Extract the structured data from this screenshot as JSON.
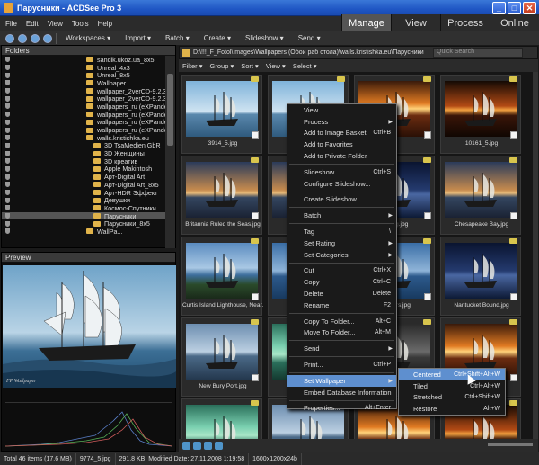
{
  "window": {
    "title": "Парусники - ACDSee Pro 3"
  },
  "menu": [
    "File",
    "Edit",
    "View",
    "Tools",
    "Help"
  ],
  "modes": [
    {
      "label": "Manage",
      "active": true
    },
    {
      "label": "View"
    },
    {
      "label": "Process"
    },
    {
      "label": "Online"
    }
  ],
  "toolbar": [
    "Workspaces ▾",
    "Import ▾",
    "Batch ▾",
    "Create ▾",
    "Slideshow ▾",
    "Send ▾"
  ],
  "folders": {
    "title": "Folders",
    "items": [
      {
        "label": "sandik.ukoz.ua_8x5",
        "indent": 0
      },
      {
        "label": "Unreal_4x3",
        "indent": 0
      },
      {
        "label": "Unreal_8x5",
        "indent": 0
      },
      {
        "label": "Wallpaper",
        "indent": 0
      },
      {
        "label": "wallpaper_2verCD-9.2.3_4x3",
        "indent": 0
      },
      {
        "label": "wallpaper_2verCD-9.2.3_8x5",
        "indent": 0
      },
      {
        "label": "wallpapers_ru (eXPanded)-1",
        "indent": 0
      },
      {
        "label": "wallpapers_ru (eXPanded)-1_",
        "indent": 0
      },
      {
        "label": "wallpapers_ru (eXPanded)-2",
        "indent": 0
      },
      {
        "label": "wallpapers_ru (eXPanded)-2_",
        "indent": 0
      },
      {
        "label": "walls.kristishka.eu",
        "indent": 0
      },
      {
        "label": "3D TsaMedien GbR",
        "indent": 1
      },
      {
        "label": "3D Женщины",
        "indent": 1
      },
      {
        "label": "3D креатив",
        "indent": 1
      },
      {
        "label": "Apple Makintosh",
        "indent": 1
      },
      {
        "label": "Арт-Digital Art",
        "indent": 1
      },
      {
        "label": "Арт-Digital Art_8x5",
        "indent": 1
      },
      {
        "label": "Арт-HDR Эффект",
        "indent": 1
      },
      {
        "label": "Девушки",
        "indent": 1
      },
      {
        "label": "Космос-Спутники",
        "indent": 1
      },
      {
        "label": "Парусники",
        "indent": 1,
        "selected": true
      },
      {
        "label": "Парусники_8x5",
        "indent": 1
      },
      {
        "label": "WallPa...",
        "indent": 0
      }
    ]
  },
  "preview": {
    "title": "Preview",
    "signature": "FP Wallpaper"
  },
  "path": {
    "text": "D:\\!!!_F_Fotol\\Images\\Wallpapers (Обои раб стола)\\walls.kristishka.eu\\Парусники",
    "search_placeholder": "Quick Search"
  },
  "filterbar": [
    "Filter ▾",
    "Group ▾",
    "Sort ▾",
    "View ▾",
    "Select ▾"
  ],
  "thumbnails": [
    {
      "caption": "3914_5.jpg",
      "scene": "ship-day"
    },
    {
      "caption": "3...",
      "scene": "ship-day"
    },
    {
      "caption": "",
      "scene": "sunset"
    },
    {
      "caption": "10161_5.jpg",
      "scene": "sunset-dark"
    },
    {
      "caption": "Britannia Ruled the Seas.jpg",
      "scene": "dusk"
    },
    {
      "caption": "Cha...",
      "scene": "dusk"
    },
    {
      "caption": "...ning.jpg",
      "scene": "night"
    },
    {
      "caption": "Chesapeake Bay.jpg",
      "scene": "dusk"
    },
    {
      "caption": "Curtis Island Lighthouse, Near...",
      "scene": "coast"
    },
    {
      "caption": "December...",
      "scene": "blue"
    },
    {
      "caption": "...velers.jpg",
      "scene": "blue"
    },
    {
      "caption": "Nantucket Bound.jpg",
      "scene": "night"
    },
    {
      "caption": "New Bury Port.jpg",
      "scene": "harbor"
    },
    {
      "caption": "New...",
      "scene": "green"
    },
    {
      "caption": "",
      "scene": "storm"
    },
    {
      "caption": "",
      "scene": "sunset"
    },
    {
      "caption": "",
      "scene": "green"
    },
    {
      "caption": "",
      "scene": "harbor"
    },
    {
      "caption": "",
      "scene": "sunset"
    },
    {
      "caption": "",
      "scene": "sunset-dark"
    }
  ],
  "context_menu": [
    {
      "label": "View"
    },
    {
      "label": "Process",
      "submenu": true
    },
    {
      "label": "Add to Image Basket",
      "shortcut": "Ctrl+B"
    },
    {
      "label": "Add to Favorites"
    },
    {
      "label": "Add to Private Folder"
    },
    {
      "divider": true
    },
    {
      "label": "Slideshow...",
      "shortcut": "Ctrl+S"
    },
    {
      "label": "Configure Slideshow..."
    },
    {
      "divider": true
    },
    {
      "label": "Create Slideshow..."
    },
    {
      "divider": true
    },
    {
      "label": "Batch",
      "submenu": true
    },
    {
      "divider": true
    },
    {
      "label": "Tag",
      "shortcut": "\\"
    },
    {
      "label": "Set Rating",
      "submenu": true
    },
    {
      "label": "Set Categories",
      "submenu": true
    },
    {
      "divider": true
    },
    {
      "label": "Cut",
      "shortcut": "Ctrl+X"
    },
    {
      "label": "Copy",
      "shortcut": "Ctrl+C"
    },
    {
      "label": "Delete",
      "shortcut": "Delete"
    },
    {
      "label": "Rename",
      "shortcut": "F2"
    },
    {
      "divider": true
    },
    {
      "label": "Copy To Folder...",
      "shortcut": "Alt+C"
    },
    {
      "label": "Move To Folder...",
      "shortcut": "Alt+M"
    },
    {
      "divider": true
    },
    {
      "label": "Send",
      "submenu": true
    },
    {
      "divider": true
    },
    {
      "label": "Print...",
      "shortcut": "Ctrl+P"
    },
    {
      "divider": true
    },
    {
      "label": "Set Wallpaper",
      "submenu": true,
      "highlighted": true
    },
    {
      "label": "Embed Database Information"
    },
    {
      "divider": true
    },
    {
      "label": "Properties...",
      "shortcut": "Alt+Enter"
    }
  ],
  "wallpaper_submenu": [
    {
      "label": "Centered",
      "shortcut": "Ctrl+Shift+Alt+W",
      "highlighted": true
    },
    {
      "label": "Tiled",
      "shortcut": "Ctrl+Alt+W"
    },
    {
      "label": "Stretched",
      "shortcut": "Ctrl+Shift+W"
    },
    {
      "label": "Restore",
      "shortcut": "Alt+W"
    }
  ],
  "status": {
    "total": "Total 46 items  (17,6 MB)",
    "file": "9774_5.jpg",
    "info": "291,8 KB, Modified Date: 27.11.2008 1:19:58",
    "dims": "1600x1200x24b"
  }
}
